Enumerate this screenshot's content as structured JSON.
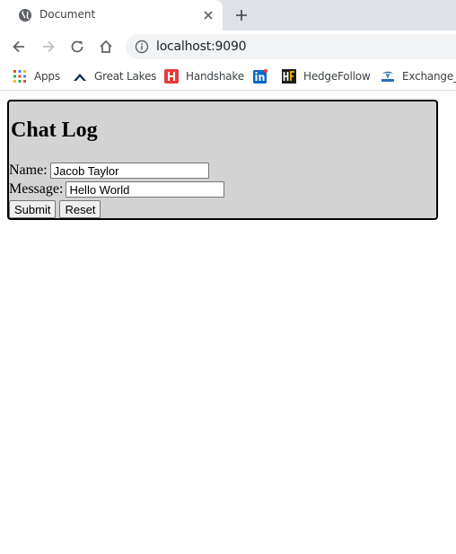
{
  "browser": {
    "tab_title": "Document",
    "url": "localhost:9090"
  },
  "bookmarks": [
    {
      "label": "Apps",
      "icon": "apps-grid-icon"
    },
    {
      "label": "Great Lakes",
      "icon": "great-lakes-icon"
    },
    {
      "label": "Handshake",
      "icon": "handshake-icon"
    },
    {
      "label": "",
      "icon": "linkedin-icon"
    },
    {
      "label": "HedgeFollow",
      "icon": "hedgefollow-icon"
    },
    {
      "label": "Exchange_M",
      "icon": "tata-icon"
    }
  ],
  "page": {
    "title": "Chat Log",
    "name_label": "Name:",
    "name_value": "Jacob Taylor",
    "message_label": "Message:",
    "message_value": "Hello World",
    "submit_label": "Submit",
    "reset_label": "Reset"
  },
  "colors": {
    "panel_background": "#d3d3d3",
    "tabstrip": "#dee1e6"
  }
}
